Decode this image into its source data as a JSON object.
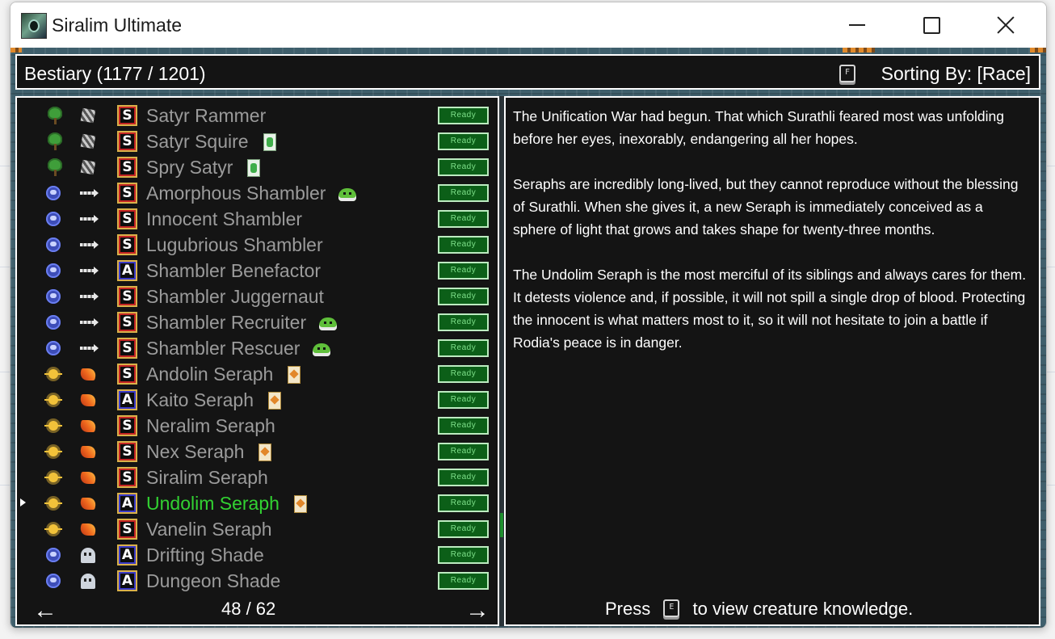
{
  "window": {
    "title": "Siralim Ultimate"
  },
  "header": {
    "title": "Bestiary (1177 / 1201)",
    "sort_key": "F",
    "sort_label": "Sorting By: [Race]"
  },
  "colors": {
    "selected": "#32d232",
    "unselected": "#9b9b9b",
    "ready_bg": "#0c5f18",
    "panel_bg": "#141414"
  },
  "list": {
    "items": [
      {
        "name": "Satyr Rammer",
        "race_icon": "tree-icon",
        "type_icon": "bone-icon",
        "class": "S",
        "extra_icon": null,
        "status": "Ready",
        "selected": false
      },
      {
        "name": "Satyr Squire",
        "race_icon": "tree-icon",
        "type_icon": "bone-icon",
        "class": "S",
        "extra_icon": "green-card-icon",
        "status": "Ready",
        "selected": false
      },
      {
        "name": "Spry Satyr",
        "race_icon": "tree-icon",
        "type_icon": "bone-icon",
        "class": "S",
        "extra_icon": "green-card-icon",
        "status": "Ready",
        "selected": false
      },
      {
        "name": "Amorphous Shambler",
        "race_icon": "orb-icon",
        "type_icon": "arrow-icon",
        "class": "S",
        "extra_icon": "slime-icon",
        "status": "Ready",
        "selected": false
      },
      {
        "name": "Innocent Shambler",
        "race_icon": "orb-icon",
        "type_icon": "arrow-icon",
        "class": "S",
        "extra_icon": null,
        "status": "Ready",
        "selected": false
      },
      {
        "name": "Lugubrious Shambler",
        "race_icon": "orb-icon",
        "type_icon": "arrow-icon",
        "class": "S",
        "extra_icon": null,
        "status": "Ready",
        "selected": false
      },
      {
        "name": "Shambler Benefactor",
        "race_icon": "orb-icon",
        "type_icon": "arrow-icon",
        "class": "A",
        "extra_icon": null,
        "status": "Ready",
        "selected": false
      },
      {
        "name": "Shambler Juggernaut",
        "race_icon": "orb-icon",
        "type_icon": "arrow-icon",
        "class": "S",
        "extra_icon": null,
        "status": "Ready",
        "selected": false
      },
      {
        "name": "Shambler Recruiter",
        "race_icon": "orb-icon",
        "type_icon": "arrow-icon",
        "class": "S",
        "extra_icon": "slime-icon",
        "status": "Ready",
        "selected": false
      },
      {
        "name": "Shambler Rescuer",
        "race_icon": "orb-icon",
        "type_icon": "arrow-icon",
        "class": "S",
        "extra_icon": "slime-icon",
        "status": "Ready",
        "selected": false
      },
      {
        "name": "Andolin Seraph",
        "race_icon": "sun-icon",
        "type_icon": "fire-icon",
        "class": "S",
        "extra_icon": "star-card-icon",
        "status": "Ready",
        "selected": false
      },
      {
        "name": "Kaito Seraph",
        "race_icon": "sun-icon",
        "type_icon": "fire-icon",
        "class": "A",
        "extra_icon": "star-card-icon",
        "status": "Ready",
        "selected": false
      },
      {
        "name": "Neralim Seraph",
        "race_icon": "sun-icon",
        "type_icon": "fire-icon",
        "class": "S",
        "extra_icon": null,
        "status": "Ready",
        "selected": false
      },
      {
        "name": "Nex Seraph",
        "race_icon": "sun-icon",
        "type_icon": "fire-icon",
        "class": "S",
        "extra_icon": "star-card-icon",
        "status": "Ready",
        "selected": false
      },
      {
        "name": "Siralim Seraph",
        "race_icon": "sun-icon",
        "type_icon": "fire-icon",
        "class": "S",
        "extra_icon": null,
        "status": "Ready",
        "selected": false
      },
      {
        "name": "Undolim Seraph",
        "race_icon": "sun-icon",
        "type_icon": "fire-icon",
        "class": "A",
        "extra_icon": "star-card-icon",
        "status": "Ready",
        "selected": true
      },
      {
        "name": "Vanelin Seraph",
        "race_icon": "sun-icon",
        "type_icon": "fire-icon",
        "class": "S",
        "extra_icon": null,
        "status": "Ready",
        "selected": false
      },
      {
        "name": "Drifting Shade",
        "race_icon": "orb-icon",
        "type_icon": "ghost-icon",
        "class": "A",
        "extra_icon": null,
        "status": "Ready",
        "selected": false
      },
      {
        "name": "Dungeon Shade",
        "race_icon": "orb-icon",
        "type_icon": "ghost-icon",
        "class": "A",
        "extra_icon": null,
        "status": "Ready",
        "selected": false
      }
    ],
    "page": "48 / 62"
  },
  "lore": {
    "paragraphs": [
      "The Unification War had begun. That which Surathli feared most was unfolding before her eyes, inexorably, endangering all her hopes.",
      "Seraphs are incredibly long-lived, but they cannot reproduce without the blessing of Surathli. When she gives it, a new Seraph is immediately conceived as a sphere of light that grows and takes shape for twenty-three months.",
      "The Undolim Seraph is the most merciful of its siblings and always cares for them. It detests violence and, if possible, it will not spill a single drop of blood. Protecting the innocent is what matters most to it, so it will not hesitate to join a battle if Rodia's peace is in danger."
    ],
    "press_prefix": "Press",
    "press_key": "E",
    "press_suffix": "to view creature knowledge."
  }
}
